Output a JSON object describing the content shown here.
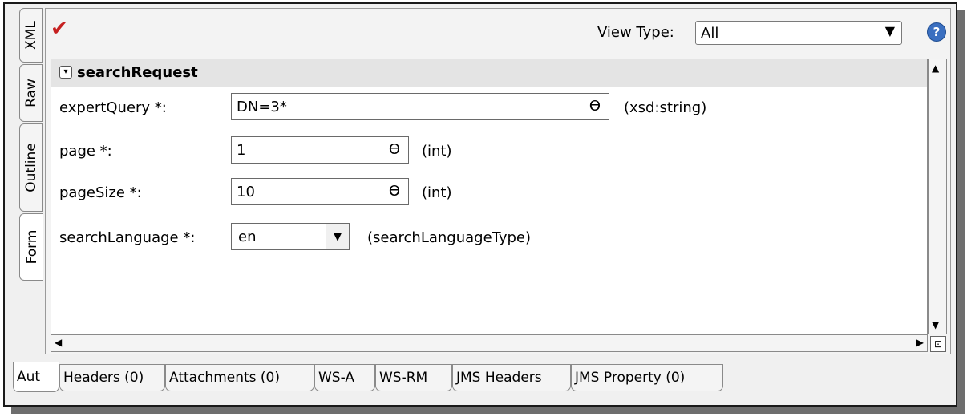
{
  "vertical_tabs": [
    "XML",
    "Raw",
    "Outline",
    "Form"
  ],
  "toolbar": {
    "check_icon": "checkmark-icon",
    "view_type_label": "View Type:",
    "view_type_value": "All",
    "help_icon": "help-icon"
  },
  "section": {
    "title": "searchRequest"
  },
  "fields": [
    {
      "label": "expertQuery *:",
      "value": "DN=3*",
      "type": "(xsd:string)"
    },
    {
      "label": "page *:",
      "value": "1",
      "type": "(int)"
    },
    {
      "label": "pageSize *:",
      "value": "10",
      "type": "(int)"
    },
    {
      "label": "searchLanguage *:",
      "value": "en",
      "type": "(searchLanguageType)"
    }
  ],
  "bottom_tabs": [
    "Aut",
    "Headers (0)",
    "Attachments (0)",
    "WS-A",
    "WS-RM",
    "JMS Headers",
    "JMS Property (0)"
  ]
}
